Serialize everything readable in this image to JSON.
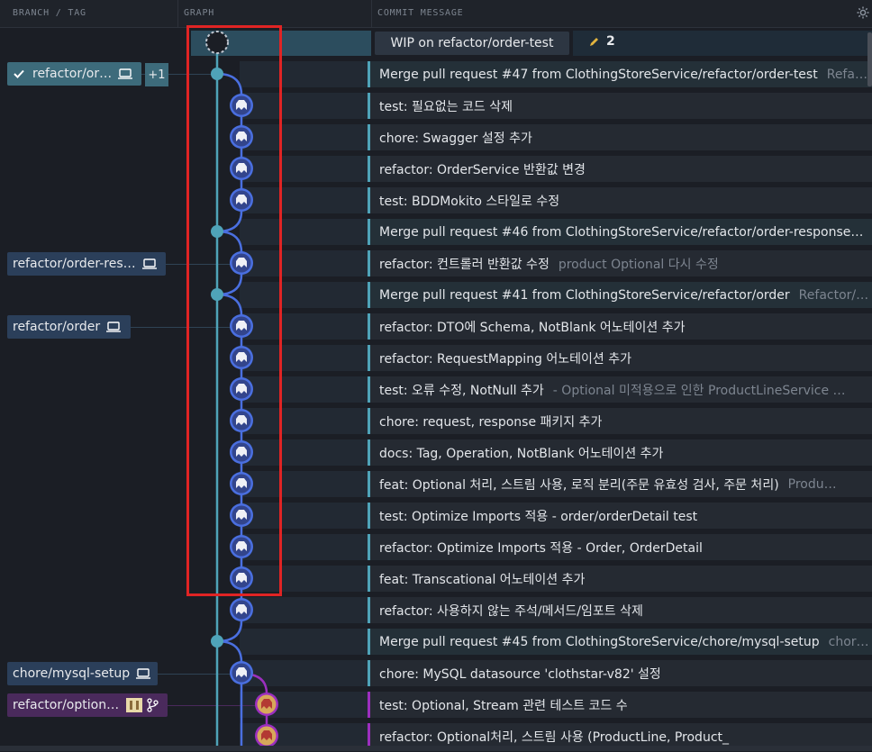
{
  "header": {
    "col_branch": "BRANCH / TAG",
    "col_graph": "GRAPH",
    "col_message": "COMMIT MESSAGE"
  },
  "wip": {
    "label": "WIP on refactor/order-test",
    "changes": "2"
  },
  "branches": {
    "b1": "refactor/or…",
    "b1_plus": "+1",
    "b2": "refactor/order-res…",
    "b3": "refactor/order",
    "b4": "chore/mysql-setup",
    "b5": "refactor/option…"
  },
  "commits": [
    {
      "msg": "Merge pull request #47 from ClothingStoreService/refactor/order-test",
      "desc": "Refa…"
    },
    {
      "msg": "test: 필요없는 코드 삭제",
      "desc": ""
    },
    {
      "msg": "chore: Swagger 설정 추가",
      "desc": ""
    },
    {
      "msg": "refactor: OrderService 반환값 변경",
      "desc": ""
    },
    {
      "msg": "test: BDDMokito 스타일로 수정",
      "desc": ""
    },
    {
      "msg": "Merge pull request #46 from ClothingStoreService/refactor/order-response…",
      "desc": ""
    },
    {
      "msg": "refactor: 컨트롤러 반환값 수정",
      "desc": "product Optional 다시 수정"
    },
    {
      "msg": "Merge pull request #41 from ClothingStoreService/refactor/order",
      "desc": "Refactor/…"
    },
    {
      "msg": "refactor: DTO에 Schema, NotBlank 어노테이션 추가",
      "desc": ""
    },
    {
      "msg": "refactor: RequestMapping 어노테이션 추가",
      "desc": ""
    },
    {
      "msg": "test: 오류 수정, NotNull 추가",
      "desc": "- Optional 미적용으로 인한 ProductLineService …"
    },
    {
      "msg": "chore: request, response 패키지 추가",
      "desc": ""
    },
    {
      "msg": "docs: Tag, Operation, NotBlank 어노테이션 추가",
      "desc": ""
    },
    {
      "msg": "feat: Optional 처리, 스트림 사용, 로직 분리(주문 유효성 검사, 주문 처리)",
      "desc": "Produ…"
    },
    {
      "msg": "test: Optimize Imports 적용 - order/orderDetail test",
      "desc": ""
    },
    {
      "msg": "refactor: Optimize Imports 적용 - Order, OrderDetail",
      "desc": ""
    },
    {
      "msg": "feat: Transcational 어노테이션 추가",
      "desc": ""
    },
    {
      "msg": "refactor: 사용하지 않는 주석/메서드/임포트 삭제",
      "desc": ""
    },
    {
      "msg": "Merge pull request #45 from ClothingStoreService/chore/mysql-setup",
      "desc": "chor…"
    },
    {
      "msg": "chore: MySQL datasource 'clothstar-v82' 설정",
      "desc": ""
    },
    {
      "msg": "test: Optional, Stream 관련 테스트 코드 수",
      "desc": ""
    },
    {
      "msg": "refactor: Optional처리, 스트림 사용 (ProductLine, Product_",
      "desc": ""
    }
  ],
  "colors": {
    "teal_line": "#4fa3b8",
    "blue_line": "#4a6fe0",
    "purple_line": "#9c2fbf",
    "highlight": "#e02424"
  },
  "icons": [
    "settings-icon",
    "pencil-icon",
    "check-icon",
    "laptop-icon",
    "branch-icon",
    "avatar-icon"
  ]
}
